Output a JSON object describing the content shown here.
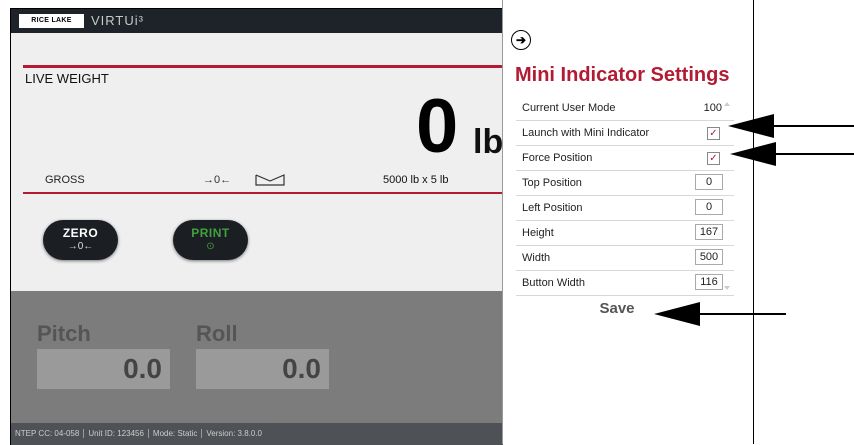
{
  "app": {
    "logo_text": "RICE LAKE",
    "brand": "VIRTUi³",
    "live_weight_label": "LIVE WEIGHT",
    "weight_value": "0",
    "weight_unit": "lb",
    "gross_label": "GROSS",
    "center_zero_symbol": "→0←",
    "capacity": "5000 lb x 5 lb",
    "zero_button": {
      "label": "ZERO",
      "sub": "→0←"
    },
    "print_button": {
      "label": "PRINT",
      "sub": "⊙"
    },
    "pitch_label": "Pitch",
    "pitch_value": "0.0",
    "roll_label": "Roll",
    "roll_value": "0.0",
    "footer": [
      "NTEP CC: 04-058",
      "Unit ID: 123456",
      "Mode: Static",
      "Version: 3.8.0.0"
    ]
  },
  "panel": {
    "back_icon": "arrow-right-icon",
    "title": "Mini Indicator Settings",
    "rows": [
      {
        "label": "Current User Mode",
        "value": "100"
      },
      {
        "label": "Launch with Mini Indicator",
        "checked": "✓"
      },
      {
        "label": "Force Position",
        "checked": "✓"
      },
      {
        "label": "Top Position",
        "value": "0"
      },
      {
        "label": "Left Position",
        "value": "0"
      },
      {
        "label": "Height",
        "value": "167"
      },
      {
        "label": "Width",
        "value": "500"
      },
      {
        "label": "Button Width",
        "value": "116"
      }
    ],
    "save_label": "Save"
  },
  "colors": {
    "accent": "#b31b34",
    "overlay": "#7c7c7c"
  }
}
